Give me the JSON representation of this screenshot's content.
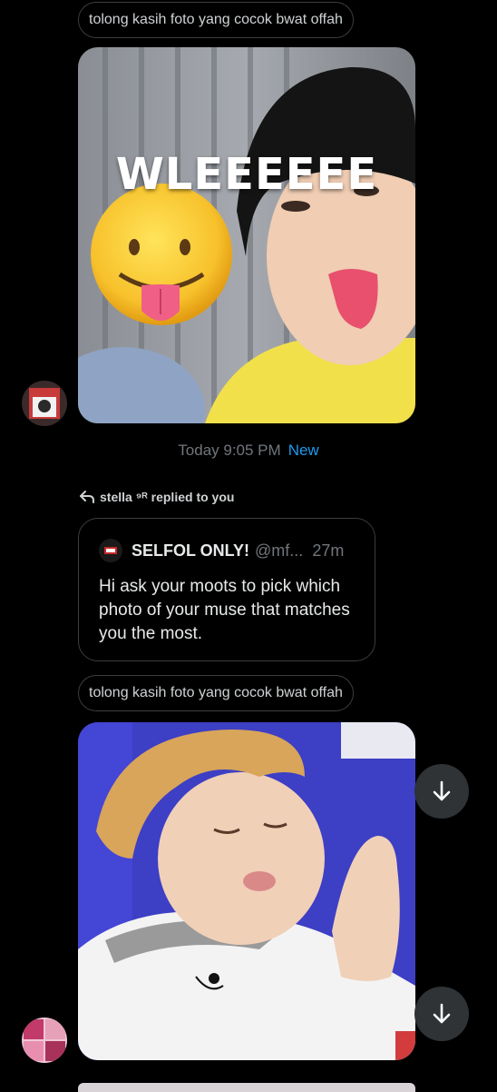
{
  "messages": [
    {
      "caption": "tolong kasih foto yang cocok bwat offah",
      "overlay_text": "WLEEEEEE"
    },
    {
      "caption": "tolong kasih foto yang cocok bwat offah"
    }
  ],
  "timestamp": {
    "time": "Today 9:05 PM",
    "new_label": "New"
  },
  "reply": {
    "text": "stella ⁹ᴿ replied to you"
  },
  "quote": {
    "name": "SELFOL ONLY!",
    "handle": "@mf...",
    "time": "27m",
    "body": "Hi ask your moots to pick which photo of your muse that matches you the most."
  },
  "icons": {
    "scroll": "arrow-down-icon",
    "reply": "reply-arrow-icon"
  },
  "colors": {
    "background": "#000000",
    "accent": "#1d9bf0",
    "muted": "#71767b",
    "border": "#3a3d40"
  }
}
